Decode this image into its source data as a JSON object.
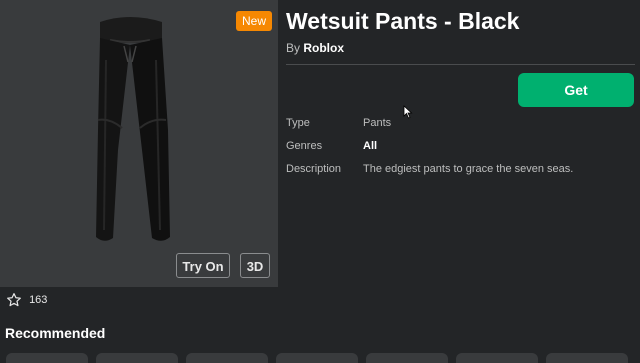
{
  "item": {
    "title": "Wetsuit Pants - Black",
    "by_prefix": "By",
    "creator": "Roblox",
    "badge": "New",
    "try_on_label": "Try On",
    "view_3d_label": "3D",
    "get_label": "Get",
    "favorites": "163"
  },
  "details": [
    {
      "key": "Type",
      "value": "Pants"
    },
    {
      "key": "Genres",
      "value": "All"
    },
    {
      "key": "Description",
      "value": "The edgiest pants to grace the seven seas."
    }
  ],
  "recommended": {
    "title": "Recommended"
  },
  "colors": {
    "accent_get": "#00b06f",
    "badge_new": "#f68802",
    "background": "#232527"
  },
  "icons": [
    "star-outline-icon",
    "cursor-icon"
  ]
}
